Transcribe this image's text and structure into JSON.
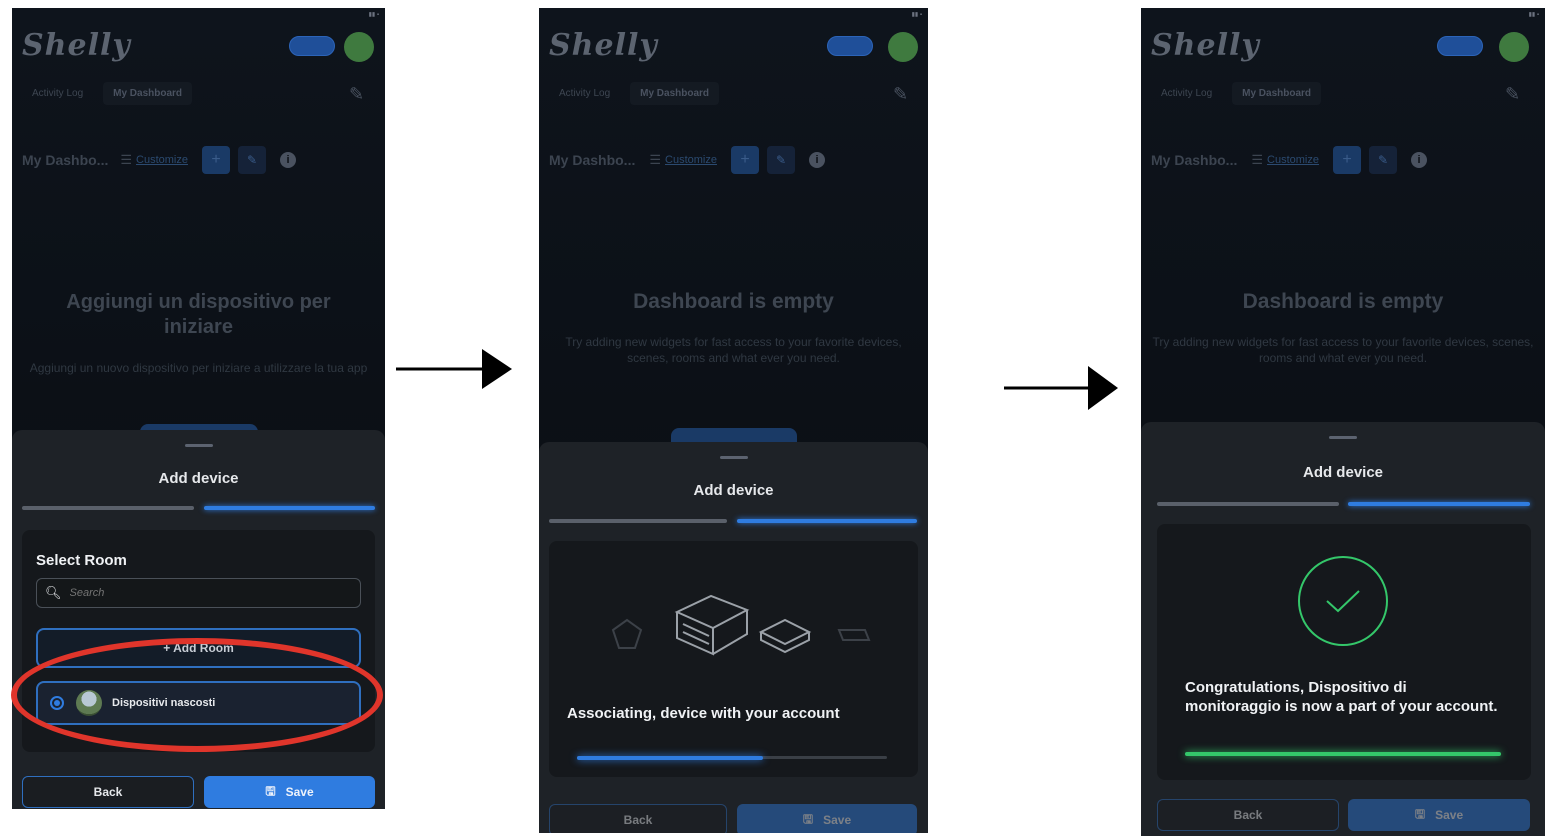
{
  "app": {
    "brand": "Shelly",
    "tabs": [
      "Activity Log",
      "My Dashboard"
    ],
    "dashboard_name": "My Dashbo...",
    "customize_label": "Customize"
  },
  "screen1": {
    "empty_title": "Aggiungi un dispositivo per iniziare",
    "empty_sub": "Aggiungi un nuovo dispositivo per iniziare a utilizzare la tua app",
    "sheet_title": "Add device",
    "select_room_title": "Select Room",
    "search_placeholder": "Search",
    "add_room_label": "+ Add Room",
    "room_name": "Dispositivi nascosti",
    "back_label": "Back",
    "save_label": "Save"
  },
  "screen2": {
    "empty_title": "Dashboard is empty",
    "empty_sub": "Try adding new widgets for fast access to your favorite devices, scenes, rooms and what ever you need.",
    "sheet_title": "Add device",
    "status_message": "Associating, device with your account",
    "progress": 0.6,
    "back_label": "Back",
    "save_label": "Save"
  },
  "screen3": {
    "empty_title": "Dashboard is empty",
    "empty_sub": "Try adding new widgets for fast access to your favorite devices, scenes, rooms and what ever you need.",
    "sheet_title": "Add device",
    "status_message": "Congratulations, Dispositivo di monitoraggio is now a part of your account.",
    "progress": 1.0,
    "back_label": "Back",
    "save_label": "Save"
  },
  "colors": {
    "accent": "#2f7ce0",
    "success": "#34c76a",
    "highlight": "#e0352b",
    "sheet": "#1e2227",
    "background": "#0d1117"
  },
  "icons": [
    "search-icon",
    "save-disk-icon",
    "check-icon",
    "pencil-icon",
    "info-icon",
    "arrow-right-icon"
  ]
}
